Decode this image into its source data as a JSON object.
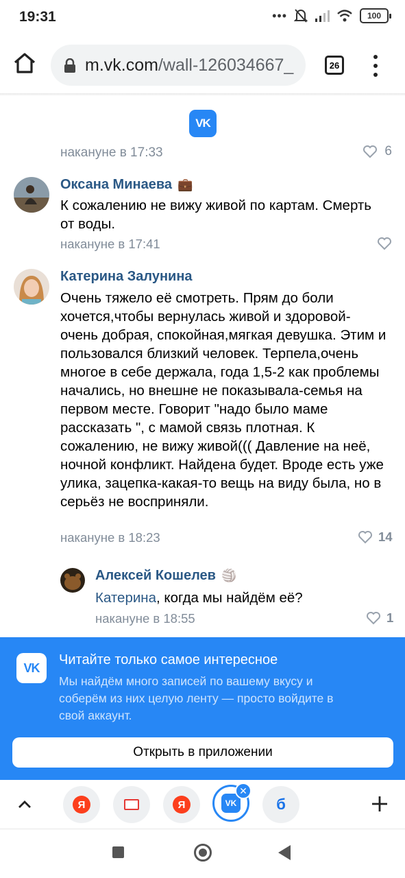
{
  "status_bar": {
    "time": "19:31",
    "battery": "100"
  },
  "browser": {
    "url_domain": "m.vk.com",
    "url_path": "/wall-126034667_",
    "tab_count": "26"
  },
  "partial_comment": {
    "time": "накануне в 17:33",
    "likes": "6"
  },
  "comments": [
    {
      "author": "Оксана Минаева",
      "badge": "💼",
      "text": "К сожалению не вижу живой по картам. Смерть от воды.",
      "time": "накануне в 17:41",
      "likes": ""
    },
    {
      "author": "Катерина Залунина",
      "text": "Очень тяжело её смотреть. Прям до боли хочется,чтобы вернулась живой и здоровой- очень добрая, спокойная,мягкая девушка. Этим и пользовался близкий человек. Терпела,очень многое в себе держала, года 1,5-2 как проблемы начались, но внешне не показывала-семья на первом месте. Говорит \"надо было маме рассказать \", с мамой связь плотная. К сожалению, не вижу живой((( Давление на неё, ночной конфликт. Найдена будет. Вроде есть уже улика, зацепка-какая-то вещь на виду была, но в серьёз не восприняли.",
      "time": "накануне в 18:23",
      "likes": "14"
    }
  ],
  "reply": {
    "author": "Алексей Кошелев",
    "badge": "🏐",
    "mention": "Катерина",
    "text": ", когда мы найдём её?",
    "time": "накануне в 18:55",
    "likes": "1"
  },
  "promo": {
    "title": "Читайте только самое интересное",
    "text": "Мы найдём много записей по вашему вкусу и соберём из них целую ленту — просто войдите в свой аккаунт.",
    "button": "Открыть в приложении"
  },
  "tabbar": {
    "ya_letter": "Я",
    "vk_letters": "VK",
    "b_letter": "б"
  },
  "colors": {
    "vk_blue": "#2787f5",
    "link": "#2a5885",
    "meta": "#818c99"
  }
}
